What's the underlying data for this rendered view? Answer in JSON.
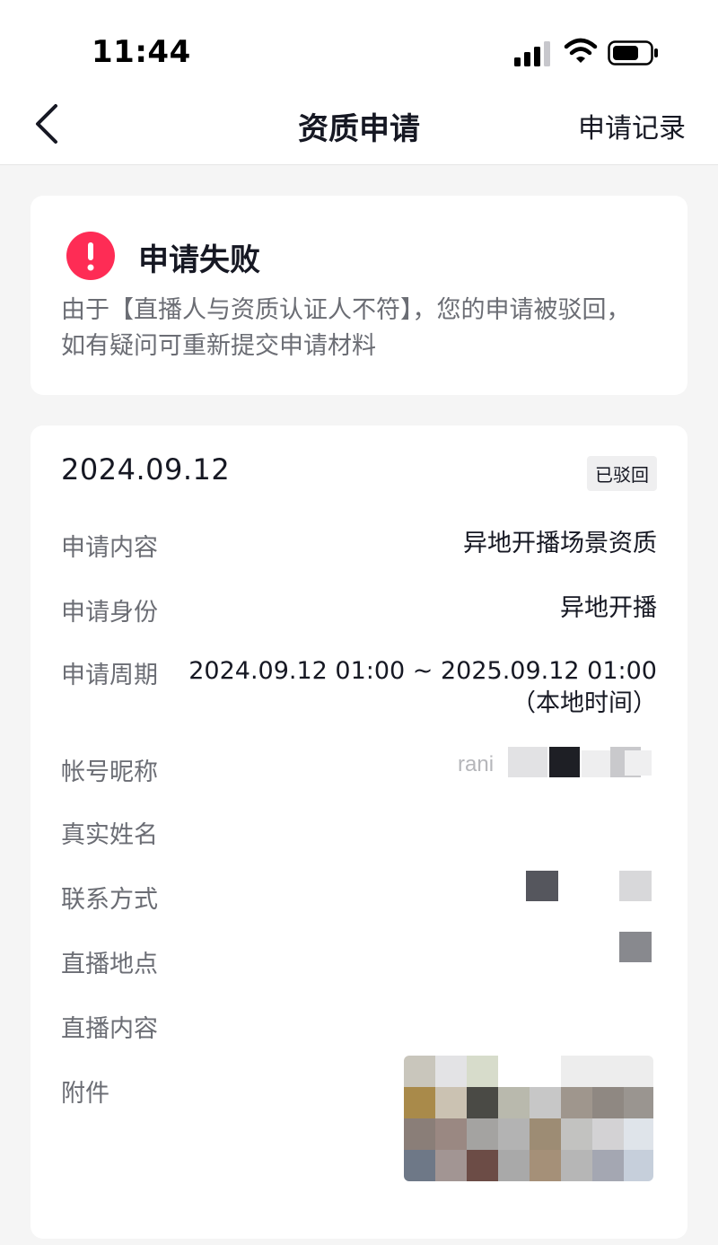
{
  "status_bar": {
    "time": "11:44",
    "icons": [
      "signal-icon",
      "wifi-icon",
      "battery-icon"
    ]
  },
  "navbar": {
    "title": "资质申请",
    "right_link": "申请记录",
    "back_icon": "chevron-left-icon"
  },
  "result": {
    "title": "申请失败",
    "description": "由于【直播人与资质认证人不符】，您的申请被驳回，如有疑问可重新提交申请材料",
    "icon": "error-exclamation-icon",
    "icon_color": "#fe2c55"
  },
  "detail": {
    "date": "2024.09.12",
    "status": "已驳回",
    "rows": [
      {
        "label": "申请内容",
        "value": "异地开播场景资质"
      },
      {
        "label": "申请身份",
        "value": "异地开播"
      },
      {
        "label": "申请周期",
        "value": "2024.09.12 01:00 ~ 2025.09.12 01:00",
        "value_extra": "（本地时间）"
      },
      {
        "label": "帐号昵称",
        "value": "rani 家苹...",
        "redacted": true
      },
      {
        "label": "真实姓名",
        "value": "",
        "redacted": true
      },
      {
        "label": "联系方式",
        "value": "",
        "redacted": true
      },
      {
        "label": "直播地点",
        "value": "",
        "redacted": true
      },
      {
        "label": "直播内容",
        "value": ""
      },
      {
        "label": "附件",
        "value": "",
        "redacted": true
      }
    ]
  },
  "colors": {
    "background": "#f5f5f5",
    "card": "#ffffff",
    "text_primary": "#161823",
    "text_secondary": "#6b6d74",
    "accent_error": "#fe2c55"
  }
}
